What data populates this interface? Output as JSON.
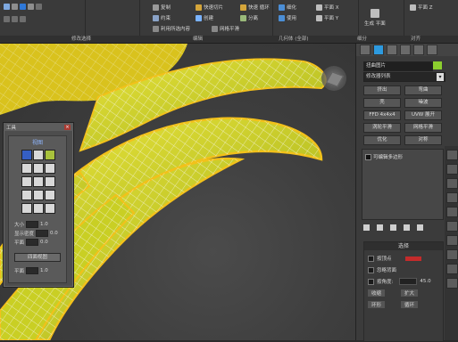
{
  "ribbon": {
    "items": [
      {
        "label": "复制",
        "icon": "copy-icon"
      },
      {
        "label": "快速切片",
        "icon": "slice-icon"
      },
      {
        "label": "快速 循环",
        "icon": "loop-icon"
      },
      {
        "label": "约束",
        "icon": "constraint-icon"
      },
      {
        "label": "创建",
        "icon": "create-icon"
      },
      {
        "label": "分离",
        "icon": "detach-icon"
      },
      {
        "label": "利用所选内容",
        "icon": "shape-icon"
      },
      {
        "label": "网格平滑",
        "icon": "smooth-icon"
      },
      {
        "label": "细化",
        "icon": "tessellate-icon"
      },
      {
        "label": "使用",
        "icon": "use-icon"
      },
      {
        "label": "平面 X",
        "icon": "plane-x-icon"
      },
      {
        "label": "平面 Y",
        "icon": "plane-y-icon"
      },
      {
        "label": "生成 平面",
        "icon": "planar-icon"
      },
      {
        "label": "平面 Z",
        "icon": "plane-z-icon"
      }
    ],
    "group_labels": [
      "修改选择",
      "编辑",
      "几何体 (全部)",
      "细分",
      "对齐"
    ]
  },
  "tools_panel": {
    "title": "工具",
    "header": "视图",
    "label_size": "大小",
    "label_density": "显示密度",
    "label_flat": "平面",
    "value_size": "1.0",
    "value_density": "0.0",
    "value_flat": "0.0",
    "button_reset": "四面视图",
    "label_plane": "平面",
    "value_plane": "1.0"
  },
  "cmd": {
    "name": "扭曲图片",
    "color": "#8ccf2e",
    "modifier_list": "修改器列表",
    "buttons": [
      "挤出",
      "弯曲",
      "壳",
      "噪波",
      "FFD 4x4x4",
      "UVW 展开",
      "涡轮平滑",
      "网格平滑",
      "优化",
      "对称"
    ],
    "stack_item": "可编辑多边形",
    "rollout_title": "选择",
    "rollout_rows": [
      "按顶点",
      "忽略背面",
      "按角度:",
      "收缩",
      "扩大",
      "环形",
      "循环"
    ],
    "angle_value": "45.0"
  }
}
